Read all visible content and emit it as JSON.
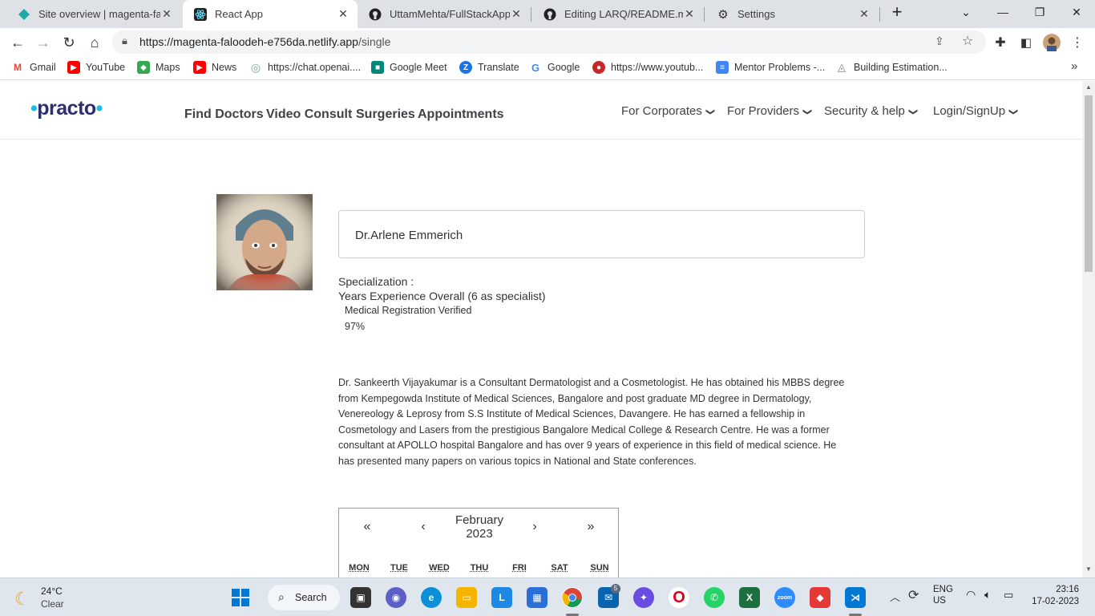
{
  "browser": {
    "tabs": [
      {
        "title": "Site overview | magenta-falo",
        "active": false,
        "favicon": "netlify-icon"
      },
      {
        "title": "React App",
        "active": true,
        "favicon": "react-icon"
      },
      {
        "title": "UttamMehta/FullStackApplic",
        "active": false,
        "favicon": "github-icon"
      },
      {
        "title": "Editing LARQ/README.md a",
        "active": false,
        "favicon": "github-icon"
      },
      {
        "title": "Settings",
        "active": false,
        "favicon": "gear-icon"
      }
    ],
    "new_tab": "+",
    "url_host": "https://magenta-faloodeh-e756da.netlify.app",
    "url_path": "/single",
    "bookmarks": [
      {
        "label": "Gmail",
        "color": "#ea4335",
        "glyph": "M"
      },
      {
        "label": "YouTube",
        "color": "#ff0000",
        "glyph": "▶"
      },
      {
        "label": "Maps",
        "color": "#34a853",
        "glyph": "◆"
      },
      {
        "label": "News",
        "color": "#ff0000",
        "glyph": "▶"
      },
      {
        "label": "https://chat.openai....",
        "color": "#74aa9c",
        "glyph": "◎"
      },
      {
        "label": "Google Meet",
        "color": "#00897b",
        "glyph": "■"
      },
      {
        "label": "Translate",
        "color": "#1a73e8",
        "glyph": "Z"
      },
      {
        "label": "Google",
        "color": "#4285f4",
        "glyph": "G"
      },
      {
        "label": "https://www.youtub...",
        "color": "#c62828",
        "glyph": "●"
      },
      {
        "label": "Mentor Problems -...",
        "color": "#4285f4",
        "glyph": "≡"
      },
      {
        "label": "Building Estimation...",
        "color": "#777777",
        "glyph": "◬"
      }
    ],
    "bookmarks_more": "»"
  },
  "site": {
    "logo_text": "practo",
    "nav": [
      "Find Doctors",
      "Video Consult",
      "Surgeries",
      "Appointments"
    ],
    "subnav": [
      "For Corporates",
      "For Providers",
      "Security & help",
      "Login/SignUp"
    ],
    "brand_color": "#14bef0"
  },
  "doctor": {
    "name": "Dr.Arlene Emmerich",
    "specialization_label": "Specialization :",
    "experience": "Years Experience Overall (6 as specialist)",
    "verified": "Medical Registration Verified",
    "rating": "97%",
    "bio": "Dr. Sankeerth Vijayakumar is a Consultant Dermatologist and a Cosmetologist. He has obtained his MBBS degree from Kempegowda Institute of Medical Sciences, Bangalore and post graduate MD degree in Dermatology, Venereology & Leprosy from S.S Institute of Medical Sciences, Davangere. He has earned a fellowship in Cosmetology and Lasers from the prestigious Bangalore Medical College & Research Centre. He was a former consultant at APOLLO hospital Bangalore and has over 9 years of experience in this field of medical science. He has presented many papers on various topics in National and State conferences."
  },
  "calendar": {
    "prev_year": "«",
    "prev_month": "‹",
    "next_month": "›",
    "next_year": "»",
    "month": "February",
    "year": "2023",
    "weekdays": [
      "MON",
      "TUE",
      "WED",
      "THU",
      "FRI",
      "SAT",
      "SUN"
    ]
  },
  "taskbar": {
    "weather_temp": "24°C",
    "weather_desc": "Clear",
    "search_label": "Search",
    "lang_top": "ENG",
    "lang_bottom": "US",
    "time": "23:16",
    "date": "17-02-2023",
    "mail_badge": "5"
  }
}
